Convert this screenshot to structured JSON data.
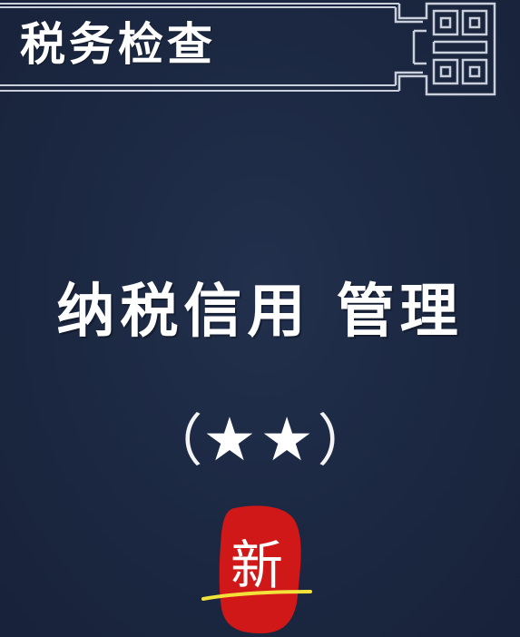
{
  "header": {
    "title": "税务检查"
  },
  "main": {
    "title": "纳税信用 管理",
    "rating": {
      "open_paren": "（",
      "stars": "★★",
      "close_paren": "）",
      "stars_count": 2
    }
  },
  "stamp": {
    "text": "新"
  },
  "colors": {
    "background": "#1b2740",
    "frame_line": "#c9d0dc",
    "text": "#ffffff",
    "stamp_red": "#d01818",
    "underline_yellow": "#f2e23a"
  }
}
